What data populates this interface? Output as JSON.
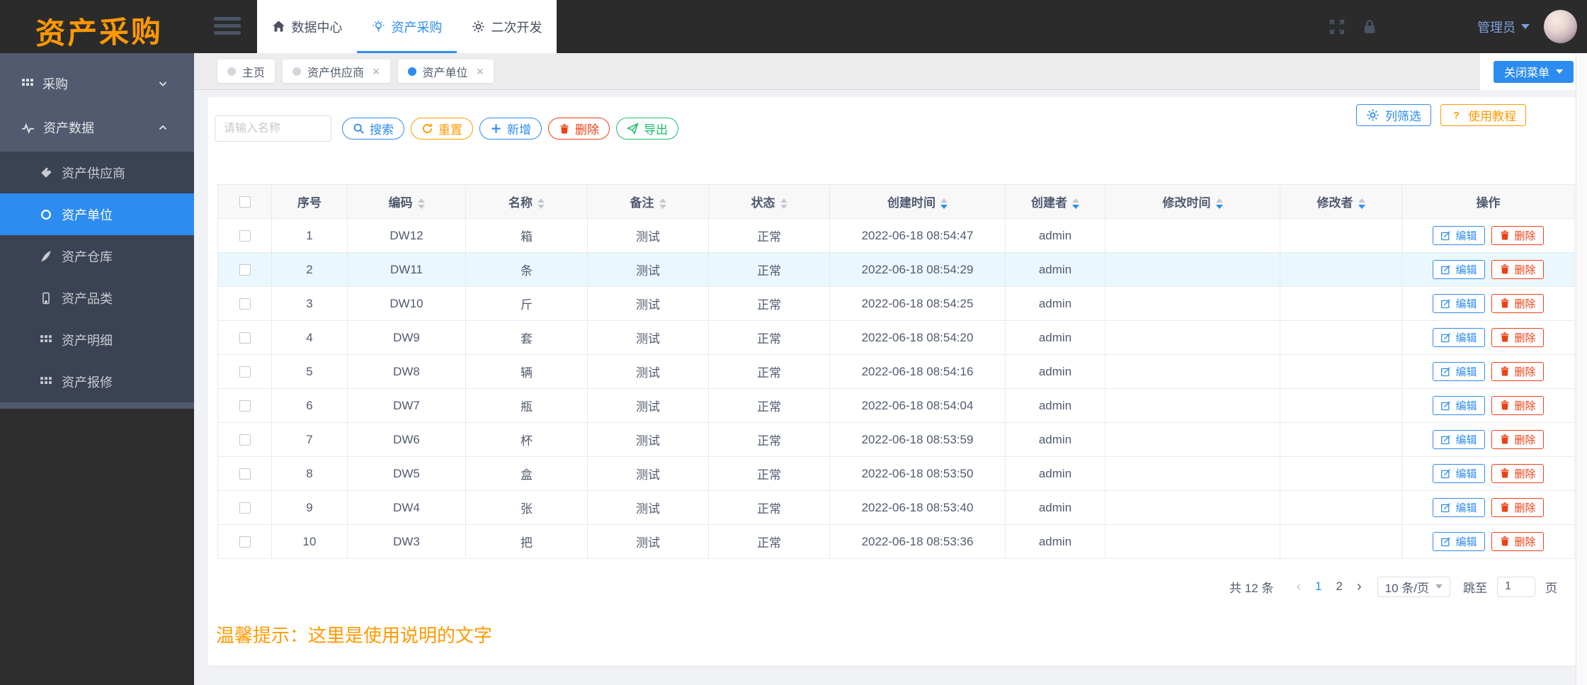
{
  "app": {
    "logo": "资产采购",
    "admin_label": "管理员"
  },
  "top_nav": {
    "tabs": [
      {
        "label": "数据中心",
        "icon": "home-icon",
        "active": false
      },
      {
        "label": "资产采购",
        "icon": "bulb-icon",
        "active": true
      },
      {
        "label": "二次开发",
        "icon": "gear-icon",
        "active": false
      }
    ]
  },
  "sidebar": {
    "groups": [
      {
        "label": "采购",
        "icon": "grid-icon",
        "expanded": false
      },
      {
        "label": "资产数据",
        "icon": "pulse-icon",
        "expanded": true
      }
    ],
    "subitems": [
      {
        "label": "资产供应商",
        "icon": "tags-icon",
        "active": false
      },
      {
        "label": "资产单位",
        "icon": "circle-icon",
        "active": true
      },
      {
        "label": "资产仓库",
        "icon": "pen-icon",
        "active": false
      },
      {
        "label": "资产品类",
        "icon": "phone-icon",
        "active": false
      },
      {
        "label": "资产明细",
        "icon": "grid-icon",
        "active": false
      },
      {
        "label": "资产报修",
        "icon": "grid-icon",
        "active": false
      }
    ]
  },
  "tab_bar": {
    "chips": [
      {
        "label": "主页",
        "closable": false,
        "active": false
      },
      {
        "label": "资产供应商",
        "closable": true,
        "active": false
      },
      {
        "label": "资产单位",
        "closable": true,
        "active": true
      }
    ],
    "close_menu_label": "关闭菜单"
  },
  "toolbar": {
    "search_placeholder": "请输入名称",
    "buttons": [
      {
        "label": "搜索",
        "icon": "search-icon",
        "color": "#2d8cf0"
      },
      {
        "label": "重置",
        "icon": "refresh-icon",
        "color": "#ff9900"
      },
      {
        "label": "新增",
        "icon": "plus-icon",
        "color": "#2d8cf0"
      },
      {
        "label": "删除",
        "icon": "trash-icon",
        "color": "#ed4014"
      },
      {
        "label": "导出",
        "icon": "send-icon",
        "color": "#19be6b"
      }
    ],
    "right_buttons": [
      {
        "label": "列筛选",
        "icon": "gear-icon",
        "color": "#2d8cf0"
      },
      {
        "label": "使用教程",
        "icon": "question-icon",
        "color": "#ff9900"
      }
    ]
  },
  "table": {
    "columns": [
      {
        "label": "",
        "type": "checkbox",
        "sort": "none"
      },
      {
        "label": "序号",
        "sort": "none"
      },
      {
        "label": "编码",
        "sort": "both"
      },
      {
        "label": "名称",
        "sort": "both"
      },
      {
        "label": "备注",
        "sort": "both"
      },
      {
        "label": "状态",
        "sort": "both"
      },
      {
        "label": "创建时间",
        "sort": "desc"
      },
      {
        "label": "创建者",
        "sort": "desc"
      },
      {
        "label": "修改时间",
        "sort": "desc"
      },
      {
        "label": "修改者",
        "sort": "desc"
      },
      {
        "label": "操作",
        "sort": "none"
      }
    ],
    "row_actions": {
      "edit": "编辑",
      "delete": "删除"
    },
    "rows": [
      {
        "index": "1",
        "code": "DW12",
        "name": "箱",
        "note": "测试",
        "status": "正常",
        "created": "2022-06-18 08:54:47",
        "creator": "admin",
        "modified": "",
        "modifier": "",
        "highlighted": false
      },
      {
        "index": "2",
        "code": "DW11",
        "name": "条",
        "note": "测试",
        "status": "正常",
        "created": "2022-06-18 08:54:29",
        "creator": "admin",
        "modified": "",
        "modifier": "",
        "highlighted": true
      },
      {
        "index": "3",
        "code": "DW10",
        "name": "斤",
        "note": "测试",
        "status": "正常",
        "created": "2022-06-18 08:54:25",
        "creator": "admin",
        "modified": "",
        "modifier": "",
        "highlighted": false
      },
      {
        "index": "4",
        "code": "DW9",
        "name": "套",
        "note": "测试",
        "status": "正常",
        "created": "2022-06-18 08:54:20",
        "creator": "admin",
        "modified": "",
        "modifier": "",
        "highlighted": false
      },
      {
        "index": "5",
        "code": "DW8",
        "name": "辆",
        "note": "测试",
        "status": "正常",
        "created": "2022-06-18 08:54:16",
        "creator": "admin",
        "modified": "",
        "modifier": "",
        "highlighted": false
      },
      {
        "index": "6",
        "code": "DW7",
        "name": "瓶",
        "note": "测试",
        "status": "正常",
        "created": "2022-06-18 08:54:04",
        "creator": "admin",
        "modified": "",
        "modifier": "",
        "highlighted": false
      },
      {
        "index": "7",
        "code": "DW6",
        "name": "杯",
        "note": "测试",
        "status": "正常",
        "created": "2022-06-18 08:53:59",
        "creator": "admin",
        "modified": "",
        "modifier": "",
        "highlighted": false
      },
      {
        "index": "8",
        "code": "DW5",
        "name": "盒",
        "note": "测试",
        "status": "正常",
        "created": "2022-06-18 08:53:50",
        "creator": "admin",
        "modified": "",
        "modifier": "",
        "highlighted": false
      },
      {
        "index": "9",
        "code": "DW4",
        "name": "张",
        "note": "测试",
        "status": "正常",
        "created": "2022-06-18 08:53:40",
        "creator": "admin",
        "modified": "",
        "modifier": "",
        "highlighted": false
      },
      {
        "index": "10",
        "code": "DW3",
        "name": "把",
        "note": "测试",
        "status": "正常",
        "created": "2022-06-18 08:53:36",
        "creator": "admin",
        "modified": "",
        "modifier": "",
        "highlighted": false
      }
    ]
  },
  "pagination": {
    "total_label": "共 12 条",
    "prev": "‹",
    "next": "›",
    "pages": [
      {
        "label": "1",
        "current": true
      },
      {
        "label": "2",
        "current": false
      }
    ],
    "page_size_label": "10 条/页",
    "jump_prefix": "跳至",
    "jump_value": "1",
    "jump_suffix": "页"
  },
  "hint_text": "温馨提示：这里是使用说明的文字",
  "colors": {
    "accent_blue": "#2d8cf0",
    "orange": "#ff9900",
    "red": "#ed4014",
    "green": "#19be6b",
    "header_dark": "#2b2b2b",
    "sidebar_slate": "#515a6e",
    "submenu_slate": "#3a4254",
    "row_highlight": "#ebf7ff"
  }
}
